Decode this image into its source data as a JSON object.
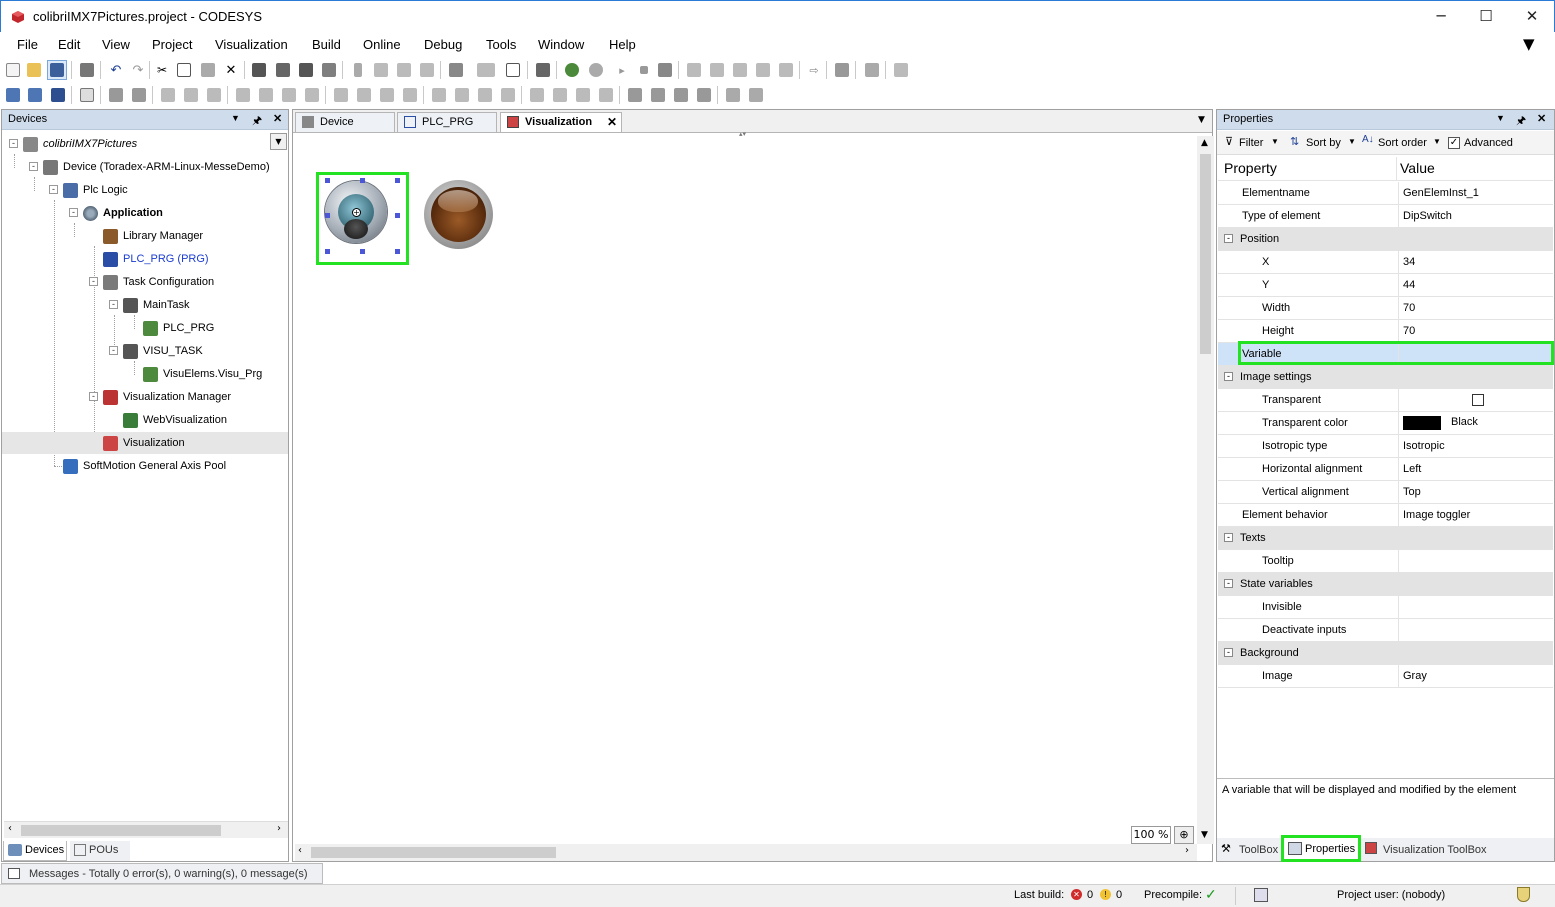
{
  "window": {
    "title": "colibriIMX7Pictures.project - CODESYS",
    "minimize": "─",
    "maximize": "☐",
    "close": "✕"
  },
  "menu": [
    "File",
    "Edit",
    "View",
    "Project",
    "Visualization",
    "Build",
    "Online",
    "Debug",
    "Tools",
    "Window",
    "Help"
  ],
  "devices_pane": {
    "title": "Devices",
    "tree": [
      {
        "label": "colibriIMX7Pictures",
        "italic": true
      },
      {
        "label": "Device (Toradex-ARM-Linux-MesseDemo)"
      },
      {
        "label": "Plc Logic"
      },
      {
        "label": "Application",
        "bold": true
      },
      {
        "label": "Library Manager"
      },
      {
        "label": "PLC_PRG (PRG)",
        "color": "#1a3ccf"
      },
      {
        "label": "Task Configuration"
      },
      {
        "label": "MainTask"
      },
      {
        "label": "PLC_PRG"
      },
      {
        "label": "VISU_TASK"
      },
      {
        "label": "VisuElems.Visu_Prg"
      },
      {
        "label": "Visualization Manager"
      },
      {
        "label": "WebVisualization"
      },
      {
        "label": "Visualization",
        "selected": true
      },
      {
        "label": "SoftMotion General Axis Pool"
      }
    ],
    "bottom_tabs": [
      "Devices",
      "POUs"
    ]
  },
  "editor": {
    "tabs": [
      "Device",
      "PLC_PRG",
      "Visualization"
    ],
    "zoom": "100 %"
  },
  "properties_pane": {
    "title": "Properties",
    "toolbar": {
      "filter": "Filter",
      "sort_by": "Sort by",
      "sort_order": "Sort order",
      "advanced": "Advanced"
    },
    "header": {
      "property": "Property",
      "value": "Value"
    },
    "rows": [
      {
        "name": "Elementname",
        "value": "GenElemInst_1",
        "level": 1
      },
      {
        "name": "Type of element",
        "value": "DipSwitch",
        "level": 1
      },
      {
        "name": "Position",
        "value": "",
        "group": true
      },
      {
        "name": "X",
        "value": "34",
        "level": 2
      },
      {
        "name": "Y",
        "value": "44",
        "level": 2
      },
      {
        "name": "Width",
        "value": "70",
        "level": 2
      },
      {
        "name": "Height",
        "value": "70",
        "level": 2
      },
      {
        "name": "Variable",
        "value": "",
        "level": 1,
        "selected": true
      },
      {
        "name": "Image settings",
        "value": "",
        "group": true
      },
      {
        "name": "Transparent",
        "value": "",
        "level": 2,
        "checkbox": true
      },
      {
        "name": "Transparent color",
        "value": "Black",
        "level": 2,
        "swatch": "#000000"
      },
      {
        "name": "Isotropic type",
        "value": "Isotropic",
        "level": 2
      },
      {
        "name": "Horizontal alignment",
        "value": "Left",
        "level": 2
      },
      {
        "name": "Vertical alignment",
        "value": "Top",
        "level": 2
      },
      {
        "name": "Element behavior",
        "value": "Image toggler",
        "level": 1
      },
      {
        "name": "Texts",
        "value": "",
        "group": true
      },
      {
        "name": "Tooltip",
        "value": "",
        "level": 2
      },
      {
        "name": "State variables",
        "value": "",
        "group": true
      },
      {
        "name": "Invisible",
        "value": "",
        "level": 2
      },
      {
        "name": "Deactivate inputs",
        "value": "",
        "level": 2
      },
      {
        "name": "Background",
        "value": "",
        "group": true
      },
      {
        "name": "Image",
        "value": "Gray",
        "level": 2
      }
    ],
    "description": "A variable that will be displayed and modified by the element",
    "bottom_tabs": [
      "ToolBox",
      "Properties",
      "Visualization ToolBox"
    ]
  },
  "messages_tab": "Messages - Totally 0 error(s), 0 warning(s), 0 message(s)",
  "status": {
    "last_build": "Last build:",
    "errors": "0",
    "warnings": "0",
    "precompile": "Precompile:",
    "project_user": "Project user: (nobody)"
  },
  "colors": {
    "highlight": "#22e222",
    "pane_header": "#cfdcec",
    "selection": "#cfe3f8"
  }
}
